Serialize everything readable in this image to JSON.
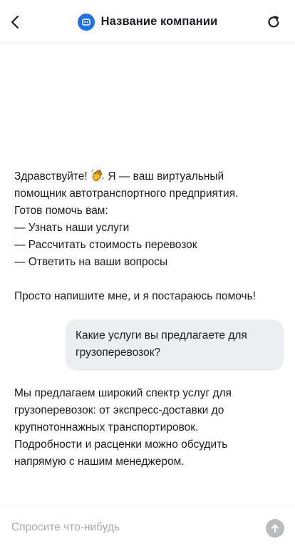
{
  "header": {
    "title": "Название компании",
    "back_icon": "chevron-left-icon",
    "logo_icon": "bot-icon",
    "refresh_icon": "refresh-icon",
    "accent_color": "#1f6feb"
  },
  "messages": [
    {
      "role": "bot",
      "greeting": "Здравствуйте!",
      "emoji": "waving-hand-icon",
      "lines": [
        "Я — ваш виртуальный",
        "помощник автотранспортного предприятия.",
        "Готов помочь вам:",
        "— Узнать наши услуги",
        "— Рассчитать стоимость перевозок",
        "— Ответить на ваши вопросы",
        "Просто напишите мне, и я постараюсь помочь!"
      ]
    },
    {
      "role": "user",
      "lines": [
        "Какие услуги вы предлагаете для",
        "грузоперевозок?"
      ]
    },
    {
      "role": "bot",
      "lines": [
        "Мы предлагаем широкий спектр услуг для",
        "грузоперевозок: от экспресс-доставки до",
        "крупнотоннажных транспортировок.",
        "Подробности и расценки можно обсудить",
        "напрямую с нашим менеджером."
      ]
    }
  ],
  "composer": {
    "placeholder": "Спросите что-нибудь",
    "value": "",
    "send_icon": "arrow-up-icon"
  }
}
